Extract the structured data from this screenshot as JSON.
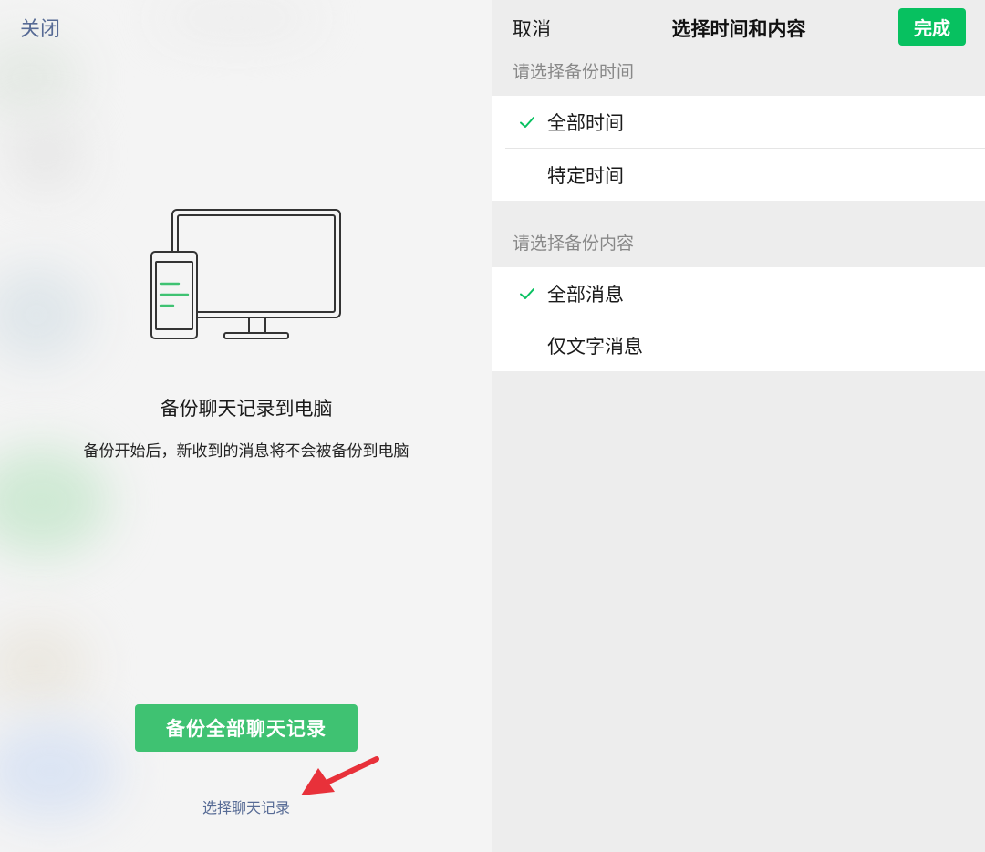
{
  "left": {
    "close_label": "关闭",
    "title": "备份聊天记录到电脑",
    "subtitle": "备份开始后，新收到的消息将不会被备份到电脑",
    "primary_button": "备份全部聊天记录",
    "select_link": "选择聊天记录",
    "icons": {
      "illustration": "computer-phone-sync-icon",
      "arrow": "red-pointer-arrow-icon"
    }
  },
  "right": {
    "cancel_label": "取消",
    "title": "选择时间和内容",
    "done_label": "完成",
    "time_section": {
      "header": "请选择备份时间",
      "options": [
        {
          "label": "全部时间",
          "checked": true
        },
        {
          "label": "特定时间",
          "checked": false
        }
      ]
    },
    "content_section": {
      "header": "请选择备份内容",
      "options": [
        {
          "label": "全部消息",
          "checked": true
        },
        {
          "label": "仅文字消息",
          "checked": false
        }
      ]
    }
  },
  "colors": {
    "accent_green": "#07c160",
    "button_green": "#3fc272",
    "link_blue": "#576b95",
    "arrow_red": "#e8313a"
  }
}
